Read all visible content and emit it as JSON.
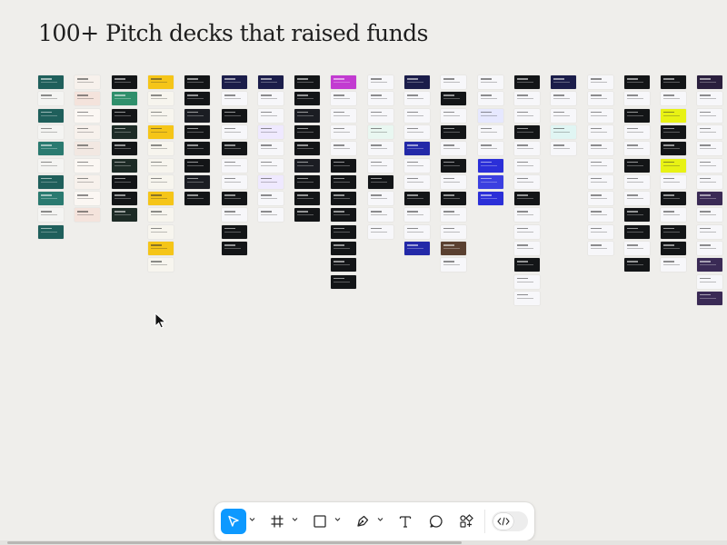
{
  "page": {
    "title": "100+ Pitch decks that raised funds"
  },
  "palette": {
    "canvas_bg": "#efeeeb",
    "accent": "#0d99ff",
    "teal": "#1f5f5b",
    "dark": "#131517",
    "yellow": "#f5c518",
    "purple": "#6e36d9",
    "navy": "#1b1d4a",
    "white": "#ffffff"
  },
  "deck_columns": [
    {
      "name": "deck-1",
      "slides": [
        "#1f5f5b",
        "#f4f4f2",
        "#1f5f5b",
        "#f4f4f2",
        "#2a7a70",
        "#f4f4f2",
        "#1f5f5b",
        "#2a7a70",
        "#f4f4f2",
        "#1f5f5b"
      ]
    },
    {
      "name": "deck-2",
      "slides": [
        "#f7f1ec",
        "#f4e3dc",
        "#fbf7f3",
        "#f7f1ec",
        "#f2e8e2",
        "#fbf7f3",
        "#f7f1ec",
        "#fbf7f3",
        "#f4e3dc"
      ]
    },
    {
      "name": "deck-3",
      "slides": [
        "#131517",
        "#2f8f6b",
        "#131517",
        "#1d2b26",
        "#131517",
        "#1d2b26",
        "#131517",
        "#131517",
        "#1d2b26"
      ]
    },
    {
      "name": "deck-4",
      "slides": [
        "#f5c518",
        "#f7f5ee",
        "#f7f5ee",
        "#f5c518",
        "#f7f5ee",
        "#f7f5ee",
        "#f7f5ee",
        "#f5c518",
        "#f7f5ee",
        "#f7f5ee",
        "#f5c518",
        "#f7f5ee"
      ]
    },
    {
      "name": "deck-5",
      "slides": [
        "#131517",
        "#131517",
        "#1b1d23",
        "#131517",
        "#131517",
        "#131517",
        "#1b1d23",
        "#131517"
      ]
    },
    {
      "name": "deck-6",
      "slides": [
        "#1b1d4a",
        "#f7f7fa",
        "#131517",
        "#f7f7fa",
        "#131517",
        "#f7f7fa",
        "#f7f7fa",
        "#131517",
        "#f7f7fa",
        "#131517",
        "#131517"
      ]
    },
    {
      "name": "deck-7",
      "slides": [
        "#1b1d4a",
        "#f7f7fa",
        "#f7f7fa",
        "#efe9ff",
        "#f7f7fa",
        "#f7f7fa",
        "#efe9ff",
        "#f7f7fa",
        "#f7f7fa"
      ]
    },
    {
      "name": "deck-8",
      "slides": [
        "#131517",
        "#131517",
        "#1b1d23",
        "#131517",
        "#131517",
        "#1b1d23",
        "#131517",
        "#131517",
        "#131517"
      ]
    },
    {
      "name": "deck-9",
      "slides": [
        "#c23bd1",
        "#f7f7fa",
        "#f7f7fa",
        "#f7f7fa",
        "#f7f7fa",
        "#131517",
        "#131517",
        "#131517",
        "#131517",
        "#131517",
        "#131517",
        "#131517",
        "#131517"
      ]
    },
    {
      "name": "deck-10",
      "slides": [
        "#f7f7fa",
        "#f7f7fa",
        "#f7f7fa",
        "#e9f7f1",
        "#f7f7fa",
        "#f7f7fa",
        "#131517",
        "#f7f7fa",
        "#f7f7fa",
        "#f7f7fa"
      ]
    },
    {
      "name": "deck-11",
      "slides": [
        "#1b1d4a",
        "#f7f7fa",
        "#f7f7fa",
        "#f7f7fa",
        "#2329a8",
        "#f7f7fa",
        "#f7f7fa",
        "#131517",
        "#f7f7fa",
        "#f7f7fa",
        "#2329a8"
      ]
    },
    {
      "name": "deck-12",
      "slides": [
        "#f7f7fa",
        "#131517",
        "#f7f7fa",
        "#131517",
        "#f7f7fa",
        "#131517",
        "#f7f7fa",
        "#131517",
        "#f7f7fa",
        "#f7f7fa",
        "#5a4030",
        "#f7f7fa"
      ]
    },
    {
      "name": "deck-13",
      "slides": [
        "#f7f7fa",
        "#f7f7fa",
        "#e6e8ff",
        "#f7f7fa",
        "#f7f7fa",
        "#2b2fd8",
        "#3b3fe0",
        "#2b2fd8"
      ]
    },
    {
      "name": "deck-14",
      "slides": [
        "#131517",
        "#f7f7fa",
        "#f7f7fa",
        "#131517",
        "#f7f7fa",
        "#f7f7fa",
        "#f7f7fa",
        "#131517",
        "#f7f7fa",
        "#f7f7fa",
        "#f7f7fa",
        "#131517",
        "#f7f7fa",
        "#f7f7fa"
      ]
    },
    {
      "name": "deck-15",
      "slides": [
        "#1b1d4a",
        "#f7f7fa",
        "#f7f7fa",
        "#e0f5f3",
        "#f7f7fa"
      ]
    },
    {
      "name": "deck-16",
      "slides": [
        "#f7f7fa",
        "#f7f7fa",
        "#f7f7fa",
        "#f7f7fa",
        "#f7f7fa",
        "#f7f7fa",
        "#f7f7fa",
        "#f7f7fa",
        "#f7f7fa",
        "#f7f7fa",
        "#f7f7fa"
      ]
    },
    {
      "name": "deck-17",
      "slides": [
        "#131517",
        "#f7f7fa",
        "#131517",
        "#f7f7fa",
        "#f7f7fa",
        "#131517",
        "#f7f7fa",
        "#f7f7fa",
        "#131517",
        "#131517",
        "#f7f7fa",
        "#131517"
      ]
    },
    {
      "name": "deck-18",
      "slides": [
        "#131517",
        "#f7f7fa",
        "#e8f214",
        "#131517",
        "#131517",
        "#e8f214",
        "#f7f7fa",
        "#131517",
        "#f7f7fa",
        "#131517",
        "#131517",
        "#f7f7fa"
      ]
    },
    {
      "name": "deck-19",
      "slides": [
        "#2a1f3d",
        "#f7f7fa",
        "#f7f7fa",
        "#f7f7fa",
        "#f7f7fa",
        "#f7f7fa",
        "#f7f7fa",
        "#3a2a55",
        "#f7f7fa",
        "#f7f7fa",
        "#f7f7fa",
        "#3a2a55",
        "#f7f7fa",
        "#3a2a55"
      ]
    }
  ],
  "toolbar": {
    "tools": [
      {
        "name": "move-tool",
        "icon": "move-icon",
        "active": true
      },
      {
        "name": "frame-tool",
        "icon": "frame-icon",
        "active": false
      },
      {
        "name": "shape-tool",
        "icon": "rectangle-icon",
        "active": false
      },
      {
        "name": "pen-tool",
        "icon": "pen-icon",
        "active": false
      },
      {
        "name": "text-tool",
        "icon": "text-icon",
        "active": false
      },
      {
        "name": "comment-tool",
        "icon": "comment-icon",
        "active": false
      },
      {
        "name": "actions-tool",
        "icon": "actions-icon",
        "active": false
      }
    ],
    "dev_mode": {
      "icon": "code-icon",
      "enabled": false
    }
  }
}
